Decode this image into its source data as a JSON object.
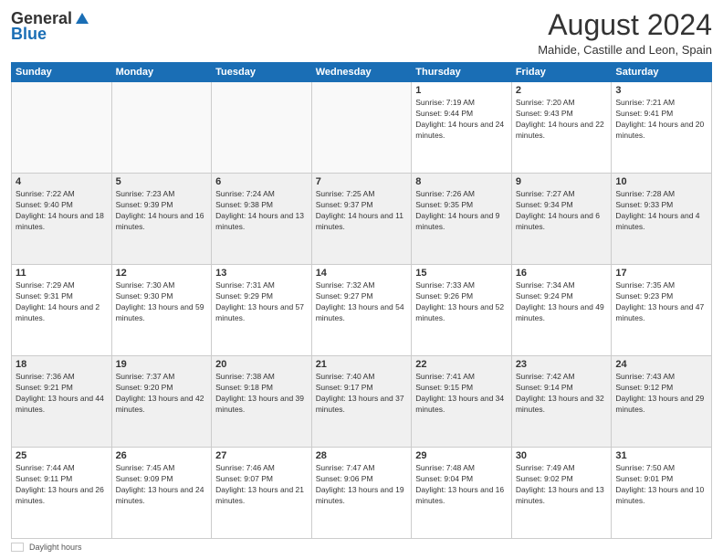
{
  "logo": {
    "general": "General",
    "blue": "Blue"
  },
  "title": "August 2024",
  "subtitle": "Mahide, Castille and Leon, Spain",
  "days_header": [
    "Sunday",
    "Monday",
    "Tuesday",
    "Wednesday",
    "Thursday",
    "Friday",
    "Saturday"
  ],
  "footer_label": "Daylight hours",
  "weeks": [
    [
      {
        "num": "",
        "info": ""
      },
      {
        "num": "",
        "info": ""
      },
      {
        "num": "",
        "info": ""
      },
      {
        "num": "",
        "info": ""
      },
      {
        "num": "1",
        "info": "Sunrise: 7:19 AM\nSunset: 9:44 PM\nDaylight: 14 hours and 24 minutes."
      },
      {
        "num": "2",
        "info": "Sunrise: 7:20 AM\nSunset: 9:43 PM\nDaylight: 14 hours and 22 minutes."
      },
      {
        "num": "3",
        "info": "Sunrise: 7:21 AM\nSunset: 9:41 PM\nDaylight: 14 hours and 20 minutes."
      }
    ],
    [
      {
        "num": "4",
        "info": "Sunrise: 7:22 AM\nSunset: 9:40 PM\nDaylight: 14 hours and 18 minutes."
      },
      {
        "num": "5",
        "info": "Sunrise: 7:23 AM\nSunset: 9:39 PM\nDaylight: 14 hours and 16 minutes."
      },
      {
        "num": "6",
        "info": "Sunrise: 7:24 AM\nSunset: 9:38 PM\nDaylight: 14 hours and 13 minutes."
      },
      {
        "num": "7",
        "info": "Sunrise: 7:25 AM\nSunset: 9:37 PM\nDaylight: 14 hours and 11 minutes."
      },
      {
        "num": "8",
        "info": "Sunrise: 7:26 AM\nSunset: 9:35 PM\nDaylight: 14 hours and 9 minutes."
      },
      {
        "num": "9",
        "info": "Sunrise: 7:27 AM\nSunset: 9:34 PM\nDaylight: 14 hours and 6 minutes."
      },
      {
        "num": "10",
        "info": "Sunrise: 7:28 AM\nSunset: 9:33 PM\nDaylight: 14 hours and 4 minutes."
      }
    ],
    [
      {
        "num": "11",
        "info": "Sunrise: 7:29 AM\nSunset: 9:31 PM\nDaylight: 14 hours and 2 minutes."
      },
      {
        "num": "12",
        "info": "Sunrise: 7:30 AM\nSunset: 9:30 PM\nDaylight: 13 hours and 59 minutes."
      },
      {
        "num": "13",
        "info": "Sunrise: 7:31 AM\nSunset: 9:29 PM\nDaylight: 13 hours and 57 minutes."
      },
      {
        "num": "14",
        "info": "Sunrise: 7:32 AM\nSunset: 9:27 PM\nDaylight: 13 hours and 54 minutes."
      },
      {
        "num": "15",
        "info": "Sunrise: 7:33 AM\nSunset: 9:26 PM\nDaylight: 13 hours and 52 minutes."
      },
      {
        "num": "16",
        "info": "Sunrise: 7:34 AM\nSunset: 9:24 PM\nDaylight: 13 hours and 49 minutes."
      },
      {
        "num": "17",
        "info": "Sunrise: 7:35 AM\nSunset: 9:23 PM\nDaylight: 13 hours and 47 minutes."
      }
    ],
    [
      {
        "num": "18",
        "info": "Sunrise: 7:36 AM\nSunset: 9:21 PM\nDaylight: 13 hours and 44 minutes."
      },
      {
        "num": "19",
        "info": "Sunrise: 7:37 AM\nSunset: 9:20 PM\nDaylight: 13 hours and 42 minutes."
      },
      {
        "num": "20",
        "info": "Sunrise: 7:38 AM\nSunset: 9:18 PM\nDaylight: 13 hours and 39 minutes."
      },
      {
        "num": "21",
        "info": "Sunrise: 7:40 AM\nSunset: 9:17 PM\nDaylight: 13 hours and 37 minutes."
      },
      {
        "num": "22",
        "info": "Sunrise: 7:41 AM\nSunset: 9:15 PM\nDaylight: 13 hours and 34 minutes."
      },
      {
        "num": "23",
        "info": "Sunrise: 7:42 AM\nSunset: 9:14 PM\nDaylight: 13 hours and 32 minutes."
      },
      {
        "num": "24",
        "info": "Sunrise: 7:43 AM\nSunset: 9:12 PM\nDaylight: 13 hours and 29 minutes."
      }
    ],
    [
      {
        "num": "25",
        "info": "Sunrise: 7:44 AM\nSunset: 9:11 PM\nDaylight: 13 hours and 26 minutes."
      },
      {
        "num": "26",
        "info": "Sunrise: 7:45 AM\nSunset: 9:09 PM\nDaylight: 13 hours and 24 minutes."
      },
      {
        "num": "27",
        "info": "Sunrise: 7:46 AM\nSunset: 9:07 PM\nDaylight: 13 hours and 21 minutes."
      },
      {
        "num": "28",
        "info": "Sunrise: 7:47 AM\nSunset: 9:06 PM\nDaylight: 13 hours and 19 minutes."
      },
      {
        "num": "29",
        "info": "Sunrise: 7:48 AM\nSunset: 9:04 PM\nDaylight: 13 hours and 16 minutes."
      },
      {
        "num": "30",
        "info": "Sunrise: 7:49 AM\nSunset: 9:02 PM\nDaylight: 13 hours and 13 minutes."
      },
      {
        "num": "31",
        "info": "Sunrise: 7:50 AM\nSunset: 9:01 PM\nDaylight: 13 hours and 10 minutes."
      }
    ]
  ]
}
